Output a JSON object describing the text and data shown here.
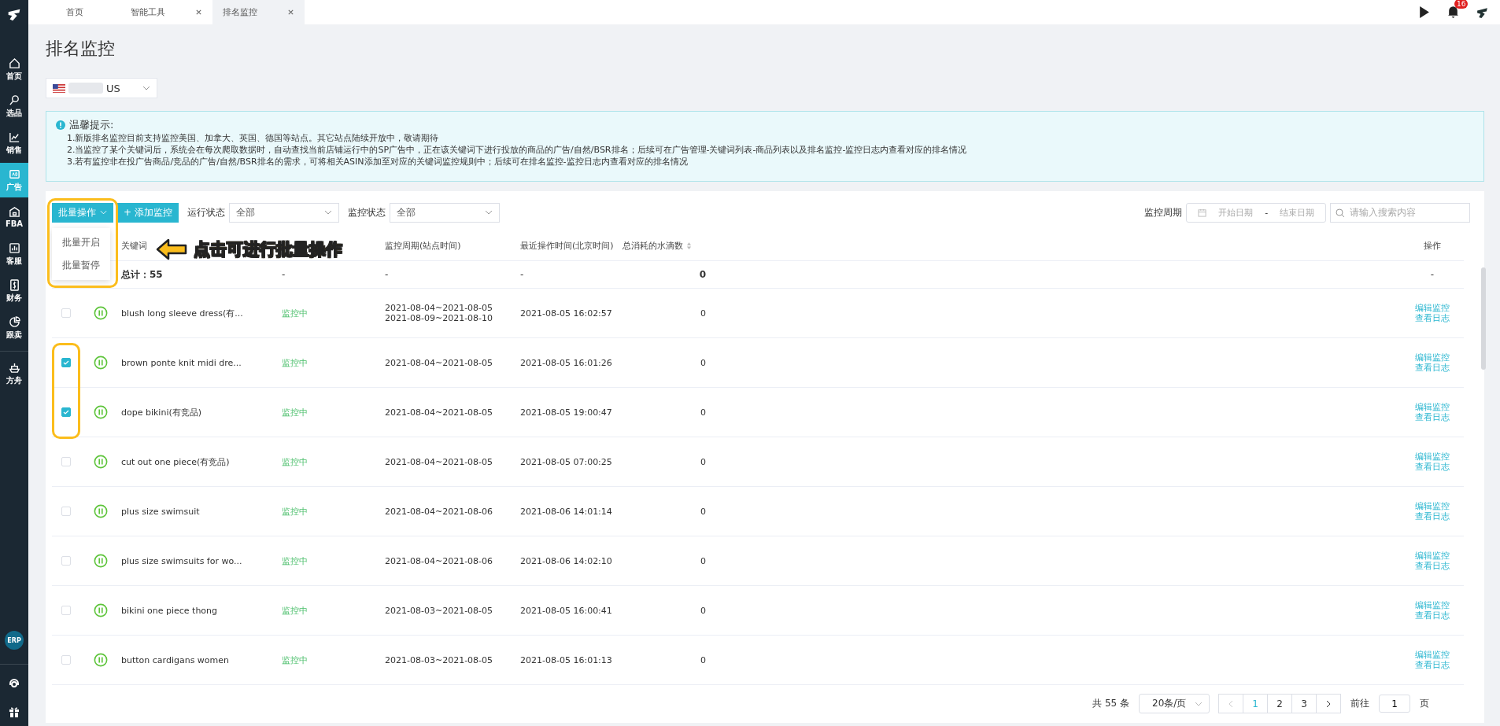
{
  "sidebar": {
    "items": [
      {
        "label": "首页",
        "selected": false
      },
      {
        "label": "选品",
        "selected": false
      },
      {
        "label": "销售",
        "selected": false
      },
      {
        "label": "广告",
        "selected": true
      },
      {
        "label": "FBA",
        "selected": false
      },
      {
        "label": "客服",
        "selected": false
      },
      {
        "label": "财务",
        "selected": false
      },
      {
        "label": "跟卖",
        "selected": false
      },
      {
        "label": "方舟",
        "selected": false
      }
    ],
    "erp": "ERP"
  },
  "tabs": [
    {
      "label": "首页",
      "closable": false,
      "selected": false
    },
    {
      "label": "智能工具",
      "closable": true,
      "selected": false
    },
    {
      "label": "排名监控",
      "closable": true,
      "selected": true
    }
  ],
  "notification_count": "16",
  "page_title": "排名监控",
  "country_select": {
    "value": "US"
  },
  "notice": {
    "title": "温馨提示:",
    "lines": [
      "1.新版排名监控目前支持监控美国、加拿大、英国、德国等站点。其它站点陆续开放中，敬请期待",
      "2.当监控了某个关键词后，系统会在每次爬取数据时，自动查找当前店铺运行中的SP广告中，正在该关键词下进行投放的商品的广告/自然/BSR排名；后续可在广告管理-关键词列表-商品列表以及排名监控-监控日志内查看对应的排名情况",
      "3.若有监控非在投广告商品/竞品的广告/自然/BSR排名的需求，可将相关ASIN添加至对应的关键词监控规则中；后续可在排名监控-监控日志内查看对应的排名情况"
    ]
  },
  "toolbar": {
    "batch_button": "批量操作",
    "batch_menu": [
      "批量开启",
      "批量暂停"
    ],
    "add_button": "+ 添加监控",
    "run_status": {
      "label": "运行状态",
      "value": "全部"
    },
    "monitor_status": {
      "label": "监控状态",
      "value": "全部"
    },
    "period": {
      "label": "监控周期",
      "start_placeholder": "开始日期",
      "separator": "-",
      "end_placeholder": "结束日期"
    },
    "search": {
      "placeholder": "请输入搜索内容"
    }
  },
  "callout": "点击可进行批量操作",
  "table": {
    "columns": [
      "关键词",
      "监控周期(站点时间)",
      "最近操作时间(北京时间)",
      "总消耗的水滴数",
      "操作"
    ],
    "total_row": {
      "label": "总计：55",
      "status": "-",
      "period": "-",
      "time": "-",
      "count": "0",
      "actions": "-"
    },
    "rows": [
      {
        "checked": false,
        "keyword": "blush long sleeve dress(有...",
        "status": "监控中",
        "periods": [
          "2021-08-04~2021-08-05",
          "2021-08-09~2021-08-10"
        ],
        "time": "2021-08-05 16:02:57",
        "count": "0",
        "actions": [
          "编辑监控",
          "查看日志"
        ]
      },
      {
        "checked": true,
        "keyword": "brown ponte knit midi dre...",
        "status": "监控中",
        "periods": [
          "2021-08-04~2021-08-05"
        ],
        "time": "2021-08-05 16:01:26",
        "count": "0",
        "actions": [
          "编辑监控",
          "查看日志"
        ]
      },
      {
        "checked": true,
        "keyword": "dope bikini(有竞品)",
        "status": "监控中",
        "periods": [
          "2021-08-04~2021-08-05"
        ],
        "time": "2021-08-05 19:00:47",
        "count": "0",
        "actions": [
          "编辑监控",
          "查看日志"
        ]
      },
      {
        "checked": false,
        "keyword": "cut out one piece(有竞品)",
        "status": "监控中",
        "periods": [
          "2021-08-04~2021-08-05"
        ],
        "time": "2021-08-05 07:00:25",
        "count": "0",
        "actions": [
          "编辑监控",
          "查看日志"
        ]
      },
      {
        "checked": false,
        "keyword": "plus size swimsuit",
        "status": "监控中",
        "periods": [
          "2021-08-04~2021-08-06"
        ],
        "time": "2021-08-06 14:01:14",
        "count": "0",
        "actions": [
          "编辑监控",
          "查看日志"
        ]
      },
      {
        "checked": false,
        "keyword": "plus size swimsuits for wo...",
        "status": "监控中",
        "periods": [
          "2021-08-04~2021-08-06"
        ],
        "time": "2021-08-06 14:02:10",
        "count": "0",
        "actions": [
          "编辑监控",
          "查看日志"
        ]
      },
      {
        "checked": false,
        "keyword": "bikini one piece thong",
        "status": "监控中",
        "periods": [
          "2021-08-03~2021-08-05"
        ],
        "time": "2021-08-05 16:00:41",
        "count": "0",
        "actions": [
          "编辑监控",
          "查看日志"
        ]
      },
      {
        "checked": false,
        "keyword": "button cardigans women",
        "status": "监控中",
        "periods": [
          "2021-08-03~2021-08-05"
        ],
        "time": "2021-08-05 16:01:13",
        "count": "0",
        "actions": [
          "编辑监控",
          "查看日志"
        ]
      }
    ]
  },
  "pagination": {
    "total": "共 55 条",
    "page_size": "20条/页",
    "pages": [
      {
        "label": "1",
        "selected": true
      },
      {
        "label": "2",
        "selected": false
      },
      {
        "label": "3",
        "selected": false
      }
    ],
    "goto_label": "前往",
    "goto_value": "1",
    "goto_suffix": "页"
  }
}
